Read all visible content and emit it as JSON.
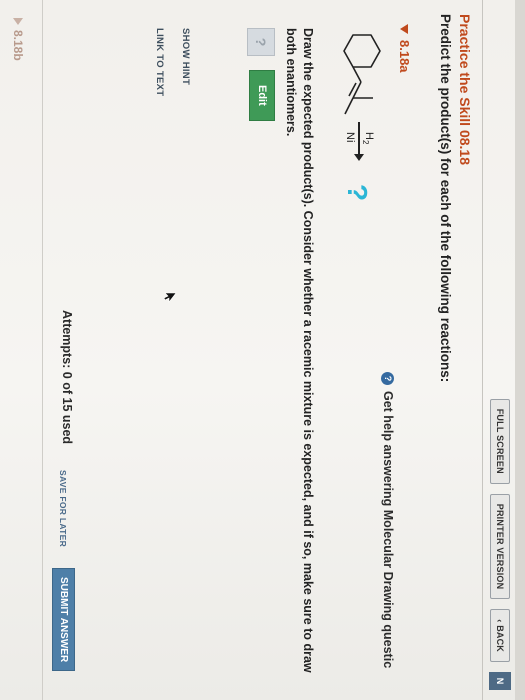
{
  "toolbar": {
    "full_screen": "FULL SCREEN",
    "printer_version": "PRINTER VERSION",
    "back": "‹ BACK",
    "corner": "N"
  },
  "problem": {
    "title": "Practice the Skill 08.18",
    "prompt": "Predict the product(s) for each of the following reactions:"
  },
  "part_a": {
    "label": "8.18a",
    "help_icon": "?",
    "help_text": "Get help answering Molecular Drawing questic",
    "reagent_top": "H",
    "reagent_top_sub": "2",
    "reagent_bottom": "Ni",
    "product": "?",
    "instructions": "Draw the expected product(s). Consider whether a racemic mixture is expected, and if so, make sure to draw both enantiomers.",
    "canvas_placeholder": "?",
    "edit_label": "Edit",
    "show_hint": "SHOW HINT",
    "link_to_text": "LINK TO TEXT",
    "attempts": "Attempts: 0 of 15 used",
    "save_for_later": "SAVE FOR LATER",
    "submit": "SUBMIT ANSWER"
  },
  "part_b": {
    "label": "8.18b"
  },
  "colors": {
    "accent_orange": "#c04a1d",
    "edit_green": "#3f9a57",
    "submit_blue": "#4e7fa8",
    "question_cyan": "#2bb6d6"
  },
  "icons": [
    "help-icon",
    "caret-down-icon",
    "caret-right-icon",
    "reaction-arrow-icon",
    "mouse-cursor-icon"
  ]
}
